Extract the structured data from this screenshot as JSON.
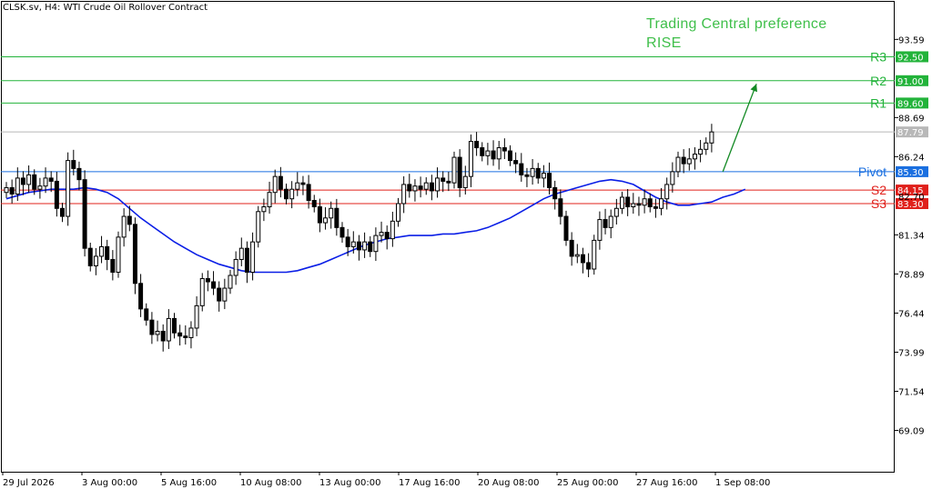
{
  "header": {
    "symbol": "CLSK.sv, H4:",
    "instrument": "WTI Crude Oil Rollover Contract"
  },
  "preference": {
    "line1": "Trading Central preference",
    "line2": "RISE"
  },
  "colors": {
    "resistance": "#22b33a",
    "support": "#e0201b",
    "pivot": "#1a6fe0",
    "ma": "#0a1ee6",
    "candle": "#000000",
    "arrow": "#138a24",
    "current": "#b8b8b8"
  },
  "chart_data": {
    "type": "candlestick",
    "ylim": [
      66.5,
      96.0
    ],
    "price_ticks": [
      "93.59",
      "88.69",
      "86.24",
      "81.34",
      "78.89",
      "76.44",
      "73.99",
      "71.54",
      "69.09"
    ],
    "time_ticks": [
      "29 Jul 2026",
      "3 Aug 00:00",
      "5 Aug 16:00",
      "10 Aug 08:00",
      "13 Aug 00:00",
      "17 Aug 16:00",
      "20 Aug 08:00",
      "25 Aug 00:00",
      "27 Aug 16:00",
      "1 Sep 08:00"
    ],
    "current_price": "87.79",
    "levels": [
      {
        "name": "R3",
        "value": 92.5,
        "label": "92.50",
        "kind": "resistance"
      },
      {
        "name": "R2",
        "value": 91.0,
        "label": "91.00",
        "kind": "resistance"
      },
      {
        "name": "R1",
        "value": 89.6,
        "label": "89.60",
        "kind": "resistance"
      },
      {
        "name": "Pivot",
        "value": 85.3,
        "label": "85.30",
        "kind": "pivot"
      },
      {
        "name": "S2",
        "value": 84.15,
        "label": "84.15",
        "kind": "support"
      },
      {
        "name": "S3",
        "value": 83.3,
        "label": "83.30",
        "kind": "support"
      }
    ],
    "partial_label": "82.70",
    "closes": [
      84.3,
      83.9,
      84.9,
      84.5,
      85.1,
      84.2,
      84.4,
      84.9,
      84.7,
      83.0,
      82.5,
      86.0,
      85.5,
      84.8,
      80.5,
      79.4,
      80.0,
      80.6,
      79.8,
      79.0,
      81.2,
      82.5,
      82.0,
      78.3,
      76.7,
      76.0,
      75.1,
      75.3,
      74.7,
      76.1,
      75.2,
      75.0,
      74.9,
      75.5,
      76.9,
      78.6,
      78.4,
      78.0,
      77.2,
      78.0,
      78.8,
      79.8,
      80.5,
      79.0,
      80.9,
      82.8,
      83.1,
      84.0,
      85.0,
      84.2,
      83.6,
      84.2,
      84.6,
      84.5,
      83.5,
      83.1,
      82.1,
      82.4,
      83.0,
      81.8,
      81.2,
      80.6,
      80.9,
      80.4,
      80.9,
      80.3,
      81.3,
      81.5,
      81.1,
      82.2,
      83.3,
      84.5,
      84.1,
      84.4,
      84.2,
      84.6,
      84.1,
      84.9,
      84.7,
      84.6,
      86.2,
      84.3,
      85.0,
      87.2,
      86.8,
      86.3,
      86.6,
      86.1,
      86.8,
      86.6,
      86.0,
      85.8,
      85.1,
      85.0,
      85.5,
      84.9,
      85.2,
      84.3,
      83.6,
      82.5,
      81.0,
      80.0,
      80.1,
      79.6,
      79.2,
      81.0,
      82.3,
      81.8,
      82.5,
      83.0,
      83.7,
      83.1,
      83.3,
      83.2,
      83.6,
      83.1,
      83.0,
      83.6,
      84.5,
      85.3,
      86.2,
      85.8,
      86.1,
      86.4,
      86.7,
      87.1,
      87.79
    ],
    "ma": [
      83.6,
      83.8,
      84.0,
      84.1,
      84.2,
      84.2,
      84.2,
      84.3,
      84.2,
      84.0,
      83.6,
      83.0,
      82.4,
      81.9,
      81.4,
      80.9,
      80.5,
      80.1,
      79.8,
      79.5,
      79.3,
      79.1,
      79.0,
      79.0,
      79.0,
      79.0,
      79.1,
      79.3,
      79.5,
      79.8,
      80.1,
      80.4,
      80.7,
      80.9,
      81.1,
      81.2,
      81.3,
      81.3,
      81.3,
      81.4,
      81.4,
      81.5,
      81.6,
      81.8,
      82.1,
      82.4,
      82.8,
      83.2,
      83.6,
      83.9,
      84.1,
      84.3,
      84.5,
      84.7,
      84.8,
      84.7,
      84.5,
      84.1,
      83.7,
      83.4,
      83.2,
      83.2,
      83.3,
      83.4,
      83.7,
      83.9,
      84.2
    ],
    "ma_start_index": 0,
    "ma_step": 2,
    "arrow_from": {
      "index": 128,
      "value": 85.3
    },
    "arrow_to": {
      "index": 134,
      "value": 90.8
    }
  }
}
